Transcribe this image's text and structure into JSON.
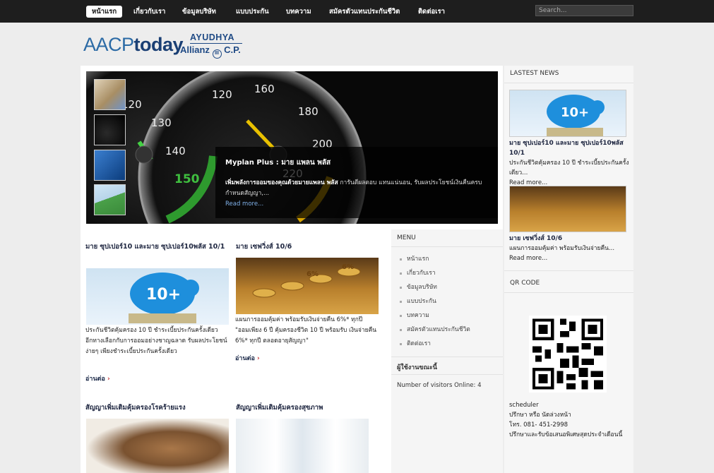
{
  "nav": {
    "items": [
      "หน้าแรก",
      "เกี่ยวกับเรา",
      "ข้อมูลบริษัท",
      "แบบประกัน",
      "บทความ",
      "สมัครตัวแทนประกันชีวิต",
      "ติดต่อเรา"
    ],
    "search_placeholder": "Search..."
  },
  "logos": {
    "aacp_light": "AACP",
    "aacp_bold": "today",
    "ayudhya": "AYUDHYA",
    "allianz": "Allianz",
    "allianz_ring": "III",
    "cp": "C.P."
  },
  "slider": {
    "title": "Myplan Plus : มาย แพลน พลัส",
    "desc_bold": "เพิ่มพลังการออมของคุณด้วยมายแพลน พลัส",
    "desc": " การันตีผลตอบ แทนแน่นอน, รับผลประโยชน์เงินคืนครบกำหนดสัญญา,...",
    "readmore": "Read more..."
  },
  "articles": [
    {
      "title": "มาย ซุปเปอร์10 และมาย ซุปเปอร์10พลัส 10/1",
      "lines": [
        "ประกันชีวิตคุ้มครอง 10 ปี ชำระเบี้ยประกันครั้งเดียว",
        "อีกทางเลือกกับการออมอย่างชาญฉลาด รับผลประโยชน์ง่ายๆ เพียงชำระเบี้ยประกันครั้งเดียว"
      ],
      "readmore": "อ่านต่อ"
    },
    {
      "title": "มาย เซฟวิ่งส์ 10/6",
      "lines": [
        "แผนการออมคุ้มค่า พร้อมรับเงินจ่ายคืน 6%* ทุกปี",
        "\"ออมเพียง 6 ปี คุ้มครองชีวิต 10 ปี พร้อมรับ เงินจ่ายคืน 6%* ทุกปี ตลอดอายุสัญญา\""
      ],
      "readmore": "อ่านต่อ"
    },
    {
      "title": "สัญญาเพิ่มเติมคุ้มครองโรคร้ายแรง"
    },
    {
      "title": "สัญญาเพิ่มเติมคุ้มครองสุขภาพ"
    }
  ],
  "menu": {
    "heading": "MENU",
    "items": [
      "หน้าแรก",
      "เกี่ยวกับเรา",
      "ข้อมูลบริษัท",
      "แบบประกัน",
      "บทความ",
      "สมัครตัวแทนประกันชีวิต",
      "ติดต่อเรา"
    ],
    "visitors_heading": "ผู้ใช้งานขณะนี้",
    "visitors_text": "Number of visitors Online: 4"
  },
  "right": {
    "latest_heading": "LASTEST NEWS",
    "news": [
      {
        "title": "มาย ซุปเปอร์10 และมาย ซุปเปอร์10พลัส 10/1",
        "desc": "ประกันชีวิตคุ้มครอง 10 ปี ชำระเบี้ยประกันครั้งเดียว...",
        "readmore": "Read more..."
      },
      {
        "title": "มาย เซฟวิ่งส์ 10/6",
        "desc": "แผนการออมคุ้มค่า พร้อมรับเงินจ่ายคืน...",
        "readmore": "Read more..."
      }
    ],
    "qr_heading": "QR CODE",
    "contact": [
      "scheduler",
      "ปรึกษา หรือ นัดล่วงหน้า",
      "โทร. 081- 451-2998",
      "ปรึกษาและรับข้อเสนอพิเศษสุดประจำเดือนนี้"
    ]
  },
  "colors": {
    "nav_bg": "#1e1e1e",
    "page_bg": "#ededed",
    "title_blue": "#202842",
    "arrow_red": "#c0292b"
  }
}
